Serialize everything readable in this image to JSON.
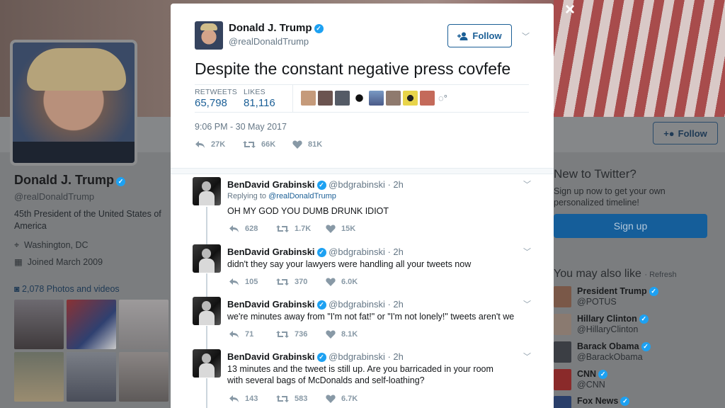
{
  "background_profile": {
    "name": "Donald J. Trump",
    "handle": "@realDonaldTrump",
    "bio": "45th President of the United States of America",
    "location": "Washington, DC",
    "joined": "Joined March 2009",
    "photos_videos": "2,078 Photos and videos",
    "follow_label": "Follow"
  },
  "sidebar": {
    "new_to_twitter": "New to Twitter?",
    "signup_text": "Sign up now to get your own personalized timeline!",
    "signup_button": "Sign up",
    "you_may_also_like": "You may also like",
    "refresh": "· Refresh",
    "suggestions": [
      {
        "name": "President Trump",
        "handle": "@POTUS"
      },
      {
        "name": "Hillary Clinton",
        "handle": "@HillaryClinton"
      },
      {
        "name": "Barack Obama",
        "handle": "@BarackObama"
      },
      {
        "name": "CNN",
        "handle": "@CNN"
      },
      {
        "name": "Fox News",
        "handle": ""
      }
    ]
  },
  "modal": {
    "close_icon": "×",
    "author_name": "Donald J. Trump",
    "author_handle": "@realDonaldTrump",
    "follow_label": "Follow",
    "tweet_text": "Despite the constant negative press covfefe",
    "retweets_label": "RETWEETS",
    "retweets_value": "65,798",
    "likes_label": "LIKES",
    "likes_value": "81,116",
    "timestamp": "9:06 PM - 30 May 2017",
    "reply_count": "27K",
    "retweet_count": "66K",
    "like_count": "81K"
  },
  "replies": [
    {
      "name": "BenDavid Grabinski",
      "handle": "@bdgrabinski",
      "time": "· 2h",
      "replying_prefix": "Replying to",
      "replying_to": "@realDonaldTrump",
      "text": "OH MY GOD YOU DUMB DRUNK IDIOT",
      "replies": "628",
      "retweets": "1.7K",
      "likes": "15K"
    },
    {
      "name": "BenDavid Grabinski",
      "handle": "@bdgrabinski",
      "time": "· 2h",
      "text": "didn't they say your lawyers were handling all your tweets now",
      "replies": "105",
      "retweets": "370",
      "likes": "6.0K"
    },
    {
      "name": "BenDavid Grabinski",
      "handle": "@bdgrabinski",
      "time": "· 2h",
      "text": "we're minutes away from \"I'm not fat!\" or \"I'm not lonely!\" tweets aren't we",
      "replies": "71",
      "retweets": "736",
      "likes": "8.1K"
    },
    {
      "name": "BenDavid Grabinski",
      "handle": "@bdgrabinski",
      "time": "· 2h",
      "text": "13 minutes and the tweet is still up. Are you barricaded in your room with several bags of McDonalds and self-loathing?",
      "replies": "143",
      "retweets": "583",
      "likes": "6.7K"
    }
  ],
  "colors": {
    "link_blue": "#1b5f96",
    "verified_blue": "#1da1f2",
    "muted_gray": "#657786"
  }
}
